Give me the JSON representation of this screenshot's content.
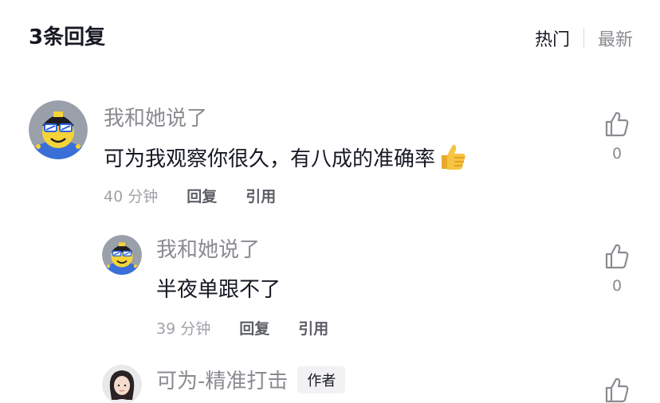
{
  "header": {
    "title": "3条回复",
    "sort_hot": "热门",
    "sort_new": "最新"
  },
  "comments": [
    {
      "username": "我和她说了",
      "text": "可为我观察你很久，有八成的准确率",
      "emoji": "thumbs-up-emoji",
      "time": "40 分钟",
      "reply_label": "回复",
      "quote_label": "引用",
      "like_count": "0"
    },
    {
      "username": "我和她说了",
      "text": "半夜单跟不了",
      "time": "39 分钟",
      "reply_label": "回复",
      "quote_label": "引用",
      "like_count": "0"
    },
    {
      "username": "可为-精准打击",
      "author_badge": "作者"
    }
  ]
}
